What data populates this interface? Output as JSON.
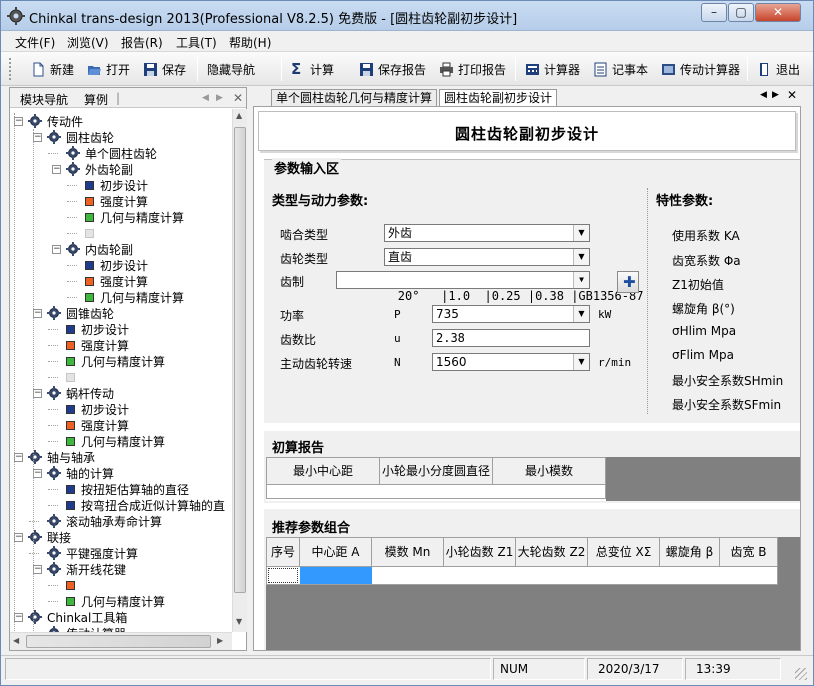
{
  "window": {
    "title": "Chinkal trans-design 2013(Professional V8.2.5)  免费版 - [圆柱齿轮副初步设计]",
    "min_label": "–",
    "max_label": "▢",
    "close_label": "✕"
  },
  "menu": [
    "文件(F)",
    "浏览(V)",
    "报告(R)",
    "工具(T)",
    "帮助(H)"
  ],
  "toolbar": {
    "new": "新建",
    "open": "打开",
    "save": "保存",
    "hide_nav": "隐藏导航",
    "calc": "计算",
    "save_report": "保存报告",
    "print_report": "打印报告",
    "calculator": "计算器",
    "notepad": "记事本",
    "trans_calc": "传动计算器",
    "exit": "退出"
  },
  "left_panel": {
    "tab_nav": "模块导航",
    "tab_example": "算例",
    "tree": [
      {
        "label": "传动件",
        "level": 0,
        "icon": "transmission-icon"
      },
      {
        "label": "圆柱齿轮",
        "level": 1,
        "icon": "gear-icon"
      },
      {
        "label": "单个圆柱齿轮",
        "level": 2,
        "icon": "gear-icon"
      },
      {
        "label": "外齿轮副",
        "level": 2,
        "icon": "gear-pair-icon"
      },
      {
        "label": "初步设计",
        "level": 3,
        "icon": "blue-square"
      },
      {
        "label": "强度计算",
        "level": 3,
        "icon": "orange-square"
      },
      {
        "label": "几何与精度计算",
        "level": 3,
        "icon": "green-square"
      },
      {
        "label": "",
        "level": 3,
        "icon": "disabled-item"
      },
      {
        "label": "内齿轮副",
        "level": 2,
        "icon": "internal-gear-icon"
      },
      {
        "label": "初步设计",
        "level": 3,
        "icon": "blue-square"
      },
      {
        "label": "强度计算",
        "level": 3,
        "icon": "orange-square"
      },
      {
        "label": "几何与精度计算",
        "level": 3,
        "icon": "green-square"
      },
      {
        "label": "圆锥齿轮",
        "level": 1,
        "icon": "bevel-gear-icon"
      },
      {
        "label": "初步设计",
        "level": 2,
        "icon": "blue-square"
      },
      {
        "label": "强度计算",
        "level": 2,
        "icon": "orange-square"
      },
      {
        "label": "几何与精度计算",
        "level": 2,
        "icon": "green-square"
      },
      {
        "label": "",
        "level": 2,
        "icon": "disabled-item"
      },
      {
        "label": "蜗杆传动",
        "level": 1,
        "icon": "worm-icon"
      },
      {
        "label": "初步设计",
        "level": 2,
        "icon": "blue-square"
      },
      {
        "label": "强度计算",
        "level": 2,
        "icon": "orange-square"
      },
      {
        "label": "几何与精度计算",
        "level": 2,
        "icon": "green-square"
      },
      {
        "label": "轴与轴承",
        "level": 0,
        "icon": "shaft-icon"
      },
      {
        "label": "轴的计算",
        "level": 1,
        "icon": "shaft-icon"
      },
      {
        "label": "按扭矩估算轴的直径",
        "level": 2,
        "icon": "blue-square"
      },
      {
        "label": "按弯扭合成近似计算轴的直",
        "level": 2,
        "icon": "blue-square"
      },
      {
        "label": "滚动轴承寿命计算",
        "level": 1,
        "icon": "bearing-icon"
      },
      {
        "label": "联接",
        "level": 0,
        "icon": "coupling-icon"
      },
      {
        "label": "平键强度计算",
        "level": 1,
        "icon": "key-icon"
      },
      {
        "label": "渐开线花键",
        "level": 1,
        "icon": "spline-icon"
      },
      {
        "label": "",
        "level": 2,
        "icon": "orange-square"
      },
      {
        "label": "几何与精度计算",
        "level": 2,
        "icon": "green-square"
      },
      {
        "label": "Chinkal工具箱",
        "level": 0,
        "icon": "tools-icon"
      },
      {
        "label": "传动计算器",
        "level": 1,
        "icon": "calculator-icon"
      }
    ]
  },
  "doc_tabs": [
    "单个圆柱齿轮几何与精度计算",
    "圆柱齿轮副初步设计"
  ],
  "page": {
    "heading": "圆柱齿轮副初步设计",
    "param_section": "参数输入区",
    "type_power": "类型与动力参数:",
    "char_params": "特性参数:",
    "mesh_type_label": "啮合类型",
    "mesh_type_value": "外齿",
    "gear_type_label": "齿轮类型",
    "gear_type_value": "直齿",
    "tooth_system_label": "齿制",
    "tooth_system_value": "20°   |1.0  |0.25 |0.38 |GB1356-87",
    "power_label": "功率",
    "power_sym": "P",
    "power_value": "735",
    "power_unit": "kW",
    "ratio_label": "齿数比",
    "ratio_sym": "u",
    "ratio_value": "2.38",
    "speed_label": "主动齿轮转速",
    "speed_sym": "N",
    "speed_value": "1560",
    "speed_unit": "r/min",
    "right_params": [
      "使用系数   KA",
      "齿宽系数   Φa",
      "Z1初始值",
      "螺旋角   β(°)",
      "σHlim     Mpa",
      "σFlim     Mpa",
      "最小安全系数SHmin",
      "最小安全系数SFmin"
    ],
    "initial_report": "初算报告",
    "report_cols": [
      "最小中心距",
      "小轮最小分度圆直径",
      "最小模数"
    ],
    "recommend": "推荐参数组合",
    "rec_cols": [
      "序号",
      "中心距 A",
      "模数 Mn",
      "小轮齿数 Z1",
      "大轮齿数 Z2",
      "总变位 XΣ",
      "螺旋角 β",
      "齿宽 B"
    ]
  },
  "status": {
    "num": "NUM",
    "date": "2020/3/17",
    "time": "13:39"
  }
}
